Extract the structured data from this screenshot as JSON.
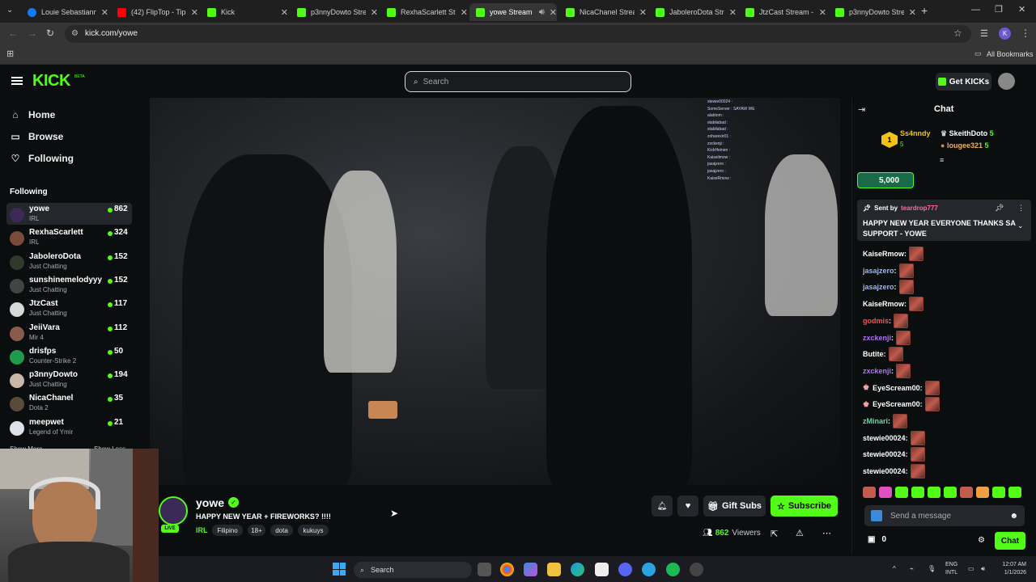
{
  "browser": {
    "tabs": [
      {
        "label": "Louie Sebastianne",
        "icon": "facebook-icon",
        "color": "#1877f2"
      },
      {
        "label": "(42) FlipTop - Tips",
        "icon": "youtube-icon",
        "color": "#ff0000"
      },
      {
        "label": "Kick",
        "icon": "kick-icon",
        "color": "#53fc18"
      },
      {
        "label": "p3nnyDowto Strea",
        "icon": "kick-icon",
        "color": "#53fc18"
      },
      {
        "label": "RexhaScarlett Stre",
        "icon": "kick-icon",
        "color": "#53fc18"
      },
      {
        "label": "yowe Stream",
        "icon": "kick-icon",
        "color": "#53fc18"
      },
      {
        "label": "NicaChanel Strean",
        "icon": "kick-icon",
        "color": "#53fc18"
      },
      {
        "label": "JaboleroDota Stre",
        "icon": "kick-icon",
        "color": "#53fc18"
      },
      {
        "label": "JtzCast Stream - V",
        "icon": "kick-icon",
        "color": "#53fc18"
      },
      {
        "label": "p3nnyDowto Strea",
        "icon": "kick-icon",
        "color": "#53fc18"
      }
    ],
    "active_tab": "yowe Stream",
    "url": "kick.com/yowe",
    "all_bookmarks": "All Bookmarks",
    "profile_initial": "K"
  },
  "header": {
    "logo": "KICK",
    "logo_badge": "BETA",
    "search_placeholder": "Search",
    "get_kicks": "Get KICKs"
  },
  "nav": {
    "home": "Home",
    "browse": "Browse",
    "following": "Following",
    "following_heading": "Following",
    "show_more": "Show More",
    "show_less": "Show Less"
  },
  "following": [
    {
      "name": "yowe",
      "category": "IRL",
      "viewers": "862",
      "avatar_color": "#3a2a55"
    },
    {
      "name": "RexhaScarlett",
      "category": "IRL",
      "viewers": "324",
      "avatar_color": "#7a4a3a"
    },
    {
      "name": "JaboleroDota",
      "category": "Just Chatting",
      "viewers": "152",
      "avatar_color": "#2f3a2a"
    },
    {
      "name": "sunshinemelodyyy",
      "category": "Just Chatting",
      "viewers": "152",
      "avatar_color": "#444"
    },
    {
      "name": "JtzCast",
      "category": "Just Chatting",
      "viewers": "117",
      "avatar_color": "#d8d8d8"
    },
    {
      "name": "JeiiVara",
      "category": "Mir 4",
      "viewers": "112",
      "avatar_color": "#8a5a4a"
    },
    {
      "name": "drisfps",
      "category": "Counter-Strike 2",
      "viewers": "50",
      "avatar_color": "#1f9a4a"
    },
    {
      "name": "p3nnyDowto",
      "category": "Just Chatting",
      "viewers": "194",
      "avatar_color": "#c9b8a8"
    },
    {
      "name": "NicaChanel",
      "category": "Dota 2",
      "viewers": "35",
      "avatar_color": "#5a4a3a"
    },
    {
      "name": "meepwet",
      "category": "Legend of Ymir",
      "viewers": "21",
      "avatar_color": "#e0e0e8"
    }
  ],
  "stream": {
    "username": "yowe",
    "title": "HAPPY NEW YEAR + FIREWORKS? !!!!",
    "category": "IRL",
    "tags": [
      "Filipino",
      "18+",
      "dota",
      "kukuys"
    ],
    "live_label": "LIVE",
    "gift_subs": "Gift Subs",
    "subscribe": "Subscribe",
    "viewers": "862",
    "viewers_label": "Viewers"
  },
  "chat": {
    "title": "Chat",
    "leaderboard": [
      {
        "rank": "1",
        "name": "Ss4nndy",
        "value": "5"
      },
      {
        "name": "SkeithDoto",
        "value": "5"
      },
      {
        "name": "lougee321",
        "value": "5"
      }
    ],
    "kicks_amount": "5,000",
    "pinned": {
      "sent_by": "Sent by",
      "user": "teardrop777",
      "message": "HAPPY NEW YEAR EVERYONE THANKS SA SUPPORT - YOWE"
    },
    "messages": [
      {
        "user": "KaiseRmow",
        "color": "#ffffff",
        "emotes": 1
      },
      {
        "user": "jasajzero",
        "color": "#9fb6ff",
        "emotes": 1
      },
      {
        "user": "jasajzero",
        "color": "#9fb6ff",
        "emotes": 1
      },
      {
        "user": "KaiseRmow",
        "color": "#ffffff",
        "emotes": 1
      },
      {
        "user": "godmis",
        "color": "#ff4e4e",
        "emotes": 1
      },
      {
        "user": "zxckenji",
        "color": "#b070ff",
        "emotes": 1
      },
      {
        "user": "Butite",
        "color": "#ffffff",
        "emotes": 1
      },
      {
        "user": "zxckenji",
        "color": "#b070ff",
        "emotes": 1
      },
      {
        "user": "EyeScream00",
        "color": "#ffffff",
        "emotes": 1
      },
      {
        "user": "EyeScream00",
        "color": "#ffffff",
        "emotes": 1
      },
      {
        "user": "zMinari",
        "color": "#5ce0a0",
        "emotes": 1
      },
      {
        "user": "stewie00024",
        "color": "#ffffff",
        "emotes": 1
      },
      {
        "user": "stewie00024",
        "color": "#ffffff",
        "emotes": 1
      },
      {
        "user": "stewie00024",
        "color": "#ffffff",
        "emotes": 1
      }
    ],
    "input_placeholder": "Send a message",
    "points": "0",
    "send": "Chat"
  },
  "overlay_chat": [
    "stewie00024 :",
    "SomeServer : SAYAW WE",
    "alabtom :",
    "stabilabad :",
    "stabilabad :",
    "zoharexir01 :",
    "zxckenji :",
    "KickHeinen :",
    "Kaiseilmow :",
    "jasajzero :",
    "jasajzero :",
    "KaiseRmow :"
  ],
  "taskbar": {
    "search": "Search",
    "lang": "ENG",
    "lang2": "INTL",
    "time": "12:07 AM",
    "date": "1/1/2026"
  },
  "colors": {
    "kick_green": "#53fc18",
    "background": "#0b0e0f",
    "panel": "#24272c"
  }
}
